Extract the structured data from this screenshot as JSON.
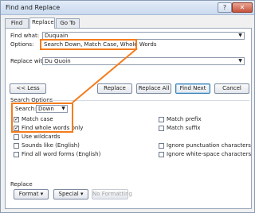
{
  "window": {
    "title": "Find and Replace",
    "help_label": "?",
    "close_label": "✕"
  },
  "tabs": [
    {
      "label": "Find"
    },
    {
      "label": "Replace",
      "selected": true
    },
    {
      "label": "Go To"
    }
  ],
  "find": {
    "label": "Find what:",
    "value": "Duquain",
    "options_label": "Options:",
    "options_value": "Search Down, Match Case, Whole Words"
  },
  "replace": {
    "label": "Replace with:",
    "value": "Du Quoin"
  },
  "buttons": {
    "less": "<< Less",
    "replace": "Replace",
    "replace_all": "Replace All",
    "find_next": "Find Next",
    "cancel": "Cancel"
  },
  "search_options": {
    "heading": "Search Options",
    "search_label": "Search:",
    "search_value": "Down",
    "left": [
      {
        "label": "Match case",
        "checked": true
      },
      {
        "label": "Find whole words only",
        "checked": true
      },
      {
        "label": "Use wildcards",
        "checked": false
      },
      {
        "label": "Sounds like (English)",
        "checked": false
      },
      {
        "label": "Find all word forms (English)",
        "checked": false
      }
    ],
    "right": [
      {
        "label": "Match prefix",
        "checked": false
      },
      {
        "label": "Match suffix",
        "checked": false
      },
      {
        "label": "Ignore punctuation characters",
        "checked": false
      },
      {
        "label": "Ignore white-space characters",
        "checked": false
      }
    ]
  },
  "replace_section": {
    "heading": "Replace",
    "format": "Format ▾",
    "special": "Special ▾",
    "no_formatting": "No Formatting"
  },
  "colors": {
    "highlight": "#f47c1d"
  }
}
